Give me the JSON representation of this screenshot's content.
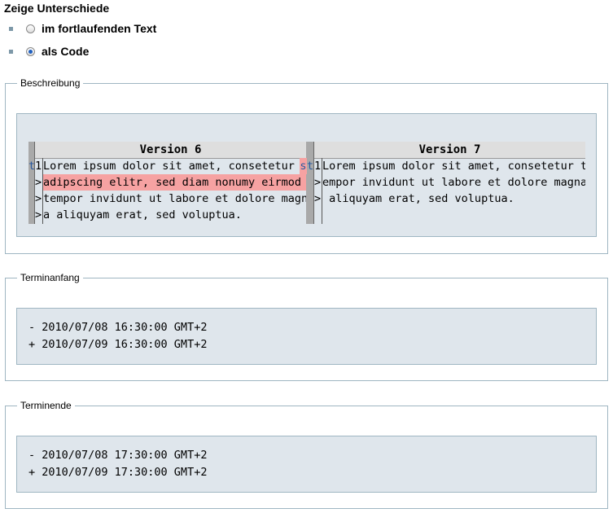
{
  "header": {
    "title": "Zeige Unterschiede"
  },
  "options": [
    {
      "label": "im fortlaufenden Text",
      "checked": false
    },
    {
      "label": "als Code",
      "checked": true
    }
  ],
  "beschreibung": {
    "legend": "Beschreibung",
    "left": {
      "title": "Version 6",
      "gutter": [
        "t",
        "",
        "",
        ""
      ],
      "markers": [
        "1",
        ">",
        ">",
        ">"
      ],
      "lines": [
        "Lorem ipsum dolor sit amet, consetetur s",
        "adipscing elitr, sed diam nonumy eirmod ",
        "tempor invidunt ut labore et dolore magn",
        "a aliquyam erat, sed voluptua."
      ],
      "highlight_suffix_line0": "s"
    },
    "right": {
      "title": "Version 7",
      "gutter": [
        "t",
        "",
        "",
        ""
      ],
      "markers": [
        "1",
        ">",
        ">",
        ""
      ],
      "lines": [
        "Lorem ipsum dolor sit amet, consetetur t",
        "empor invidunt ut labore et dolore magna",
        " aliquyam erat, sed voluptua."
      ]
    },
    "highlight_color": "#f6a2a2"
  },
  "terminanfang": {
    "legend": "Terminanfang",
    "lines": [
      "- 2010/07/08 16:30:00 GMT+2",
      "+ 2010/07/09 16:30:00 GMT+2"
    ]
  },
  "terminende": {
    "legend": "Terminende",
    "lines": [
      "- 2010/07/08 17:30:00 GMT+2",
      "+ 2010/07/09 17:30:00 GMT+2"
    ]
  }
}
